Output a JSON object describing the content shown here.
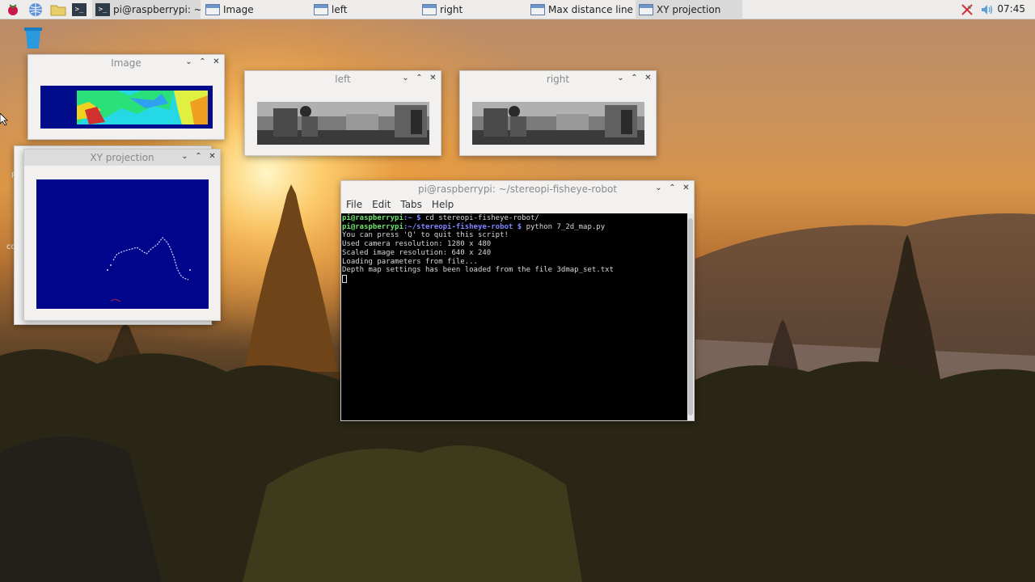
{
  "taskbar": {
    "tasks": [
      {
        "label": "pi@raspberrypi: ~/ste..."
      },
      {
        "label": "Image"
      },
      {
        "label": "left"
      },
      {
        "label": "right"
      },
      {
        "label": "Max distance line"
      },
      {
        "label": "XY projection"
      }
    ],
    "clock": "07:45"
  },
  "windows": {
    "image": {
      "title": "Image"
    },
    "left": {
      "title": "left"
    },
    "right": {
      "title": "right"
    },
    "xy": {
      "title": "XY projection"
    },
    "terminal": {
      "title": "pi@raspberrypi: ~/stereopi-fisheye-robot",
      "menu": [
        "File",
        "Edit",
        "Tabs",
        "Help"
      ],
      "lines": [
        {
          "user": "pi@raspberrypi",
          "path": ":~ $",
          "cmd": " cd stereopi-fisheye-robot/"
        },
        {
          "user": "pi@raspberrypi",
          "path": ":~/stereopi-fisheye-robot $",
          "cmd": " python 7_2d_map.py"
        },
        {
          "text": "You can press 'Q' to quit this script!"
        },
        {
          "text": "Used camera resolution: 1280 x 480"
        },
        {
          "text": "Scaled image resolution: 640 x 240"
        },
        {
          "text": "Loading parameters from file..."
        },
        {
          "text": "Depth map settings has been loaded from the file 3dmap_set.txt"
        }
      ]
    }
  },
  "desktop": {
    "labels": [
      "Re",
      "co"
    ]
  },
  "icons": {
    "launcher": [
      "raspberry-icon",
      "globe-icon",
      "folder-icon",
      "terminal-icon"
    ],
    "tray": [
      "network-icon",
      "volume-icon"
    ]
  }
}
